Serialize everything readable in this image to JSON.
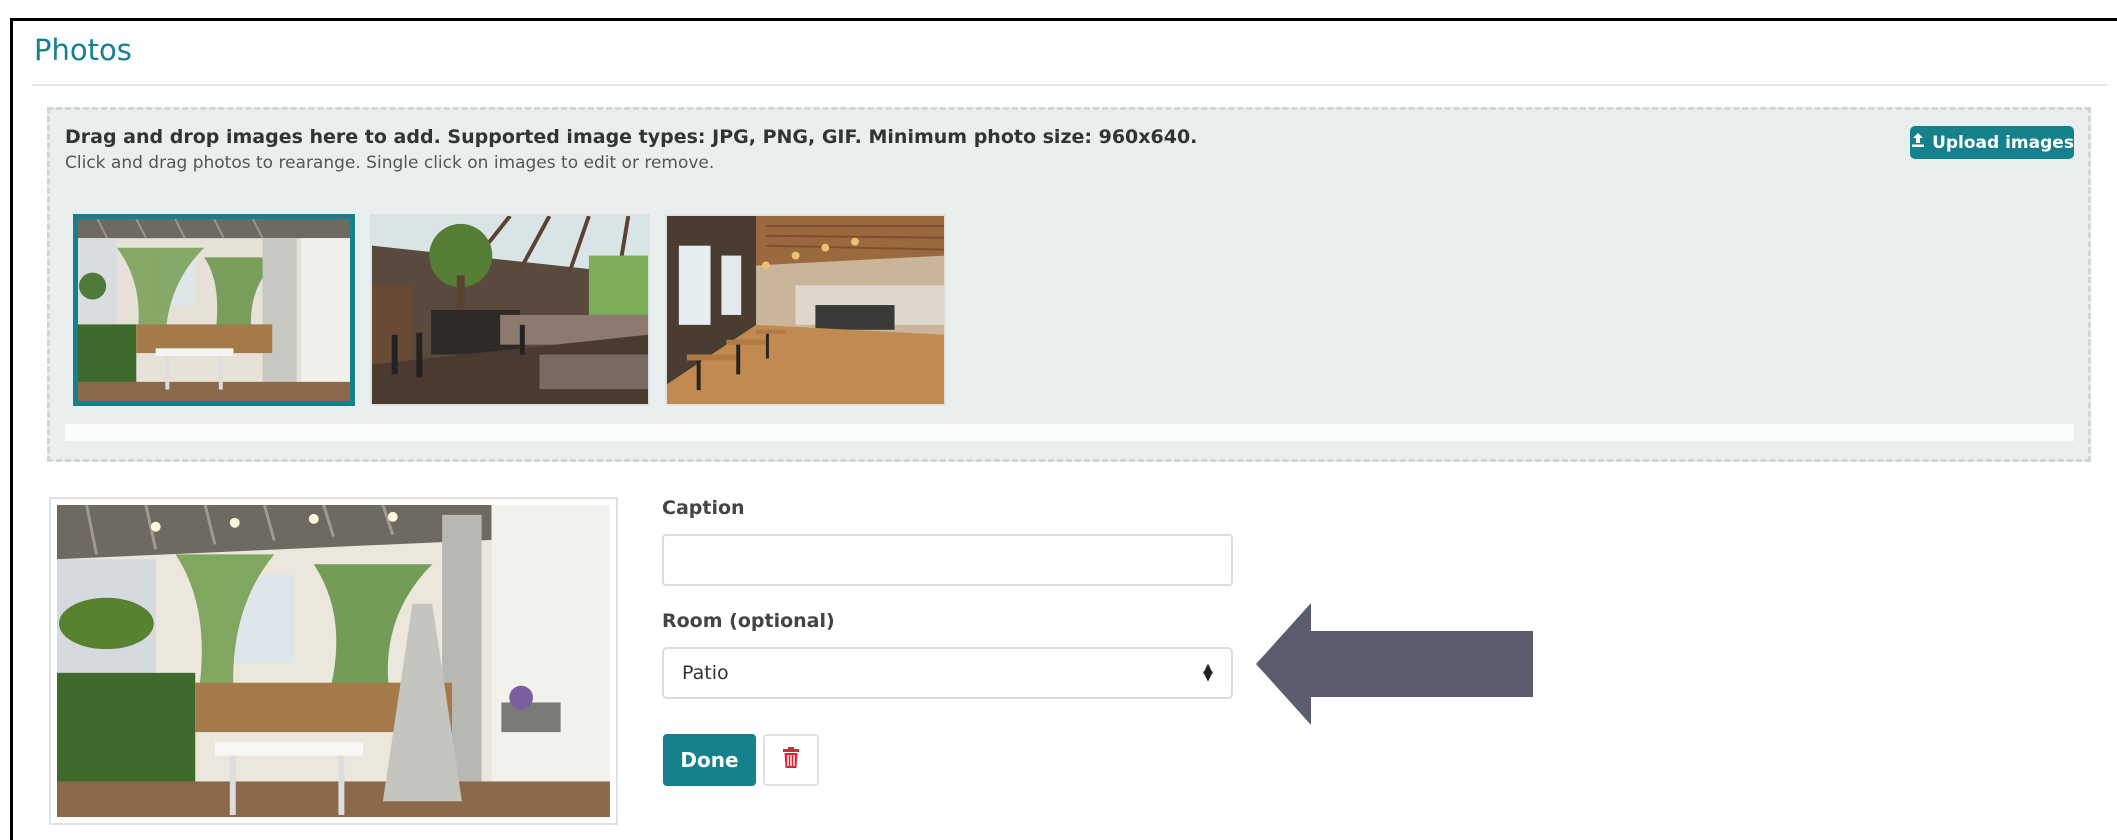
{
  "section": {
    "title": "Photos"
  },
  "dropzone": {
    "instructions": "Drag and drop images here to add. Supported image types: JPG, PNG, GIF. Minimum photo size: 960x640.",
    "hint": "Click and drag photos to rearange. Single click on images to edit or remove.",
    "upload_label": "Upload images",
    "upload_icon": "upload-icon"
  },
  "thumbnails": [
    {
      "name": "patio",
      "selected": true
    },
    {
      "name": "greenhouse-dining-room",
      "selected": false
    },
    {
      "name": "restaurant-hall",
      "selected": false
    }
  ],
  "editor": {
    "caption_label": "Caption",
    "caption_value": "",
    "room_label": "Room (optional)",
    "room_value": "Patio",
    "done_label": "Done",
    "delete_icon": "trash-icon"
  },
  "colors": {
    "accent": "#15818d",
    "danger": "#d9263d",
    "arrow": "#5a5d6e"
  }
}
